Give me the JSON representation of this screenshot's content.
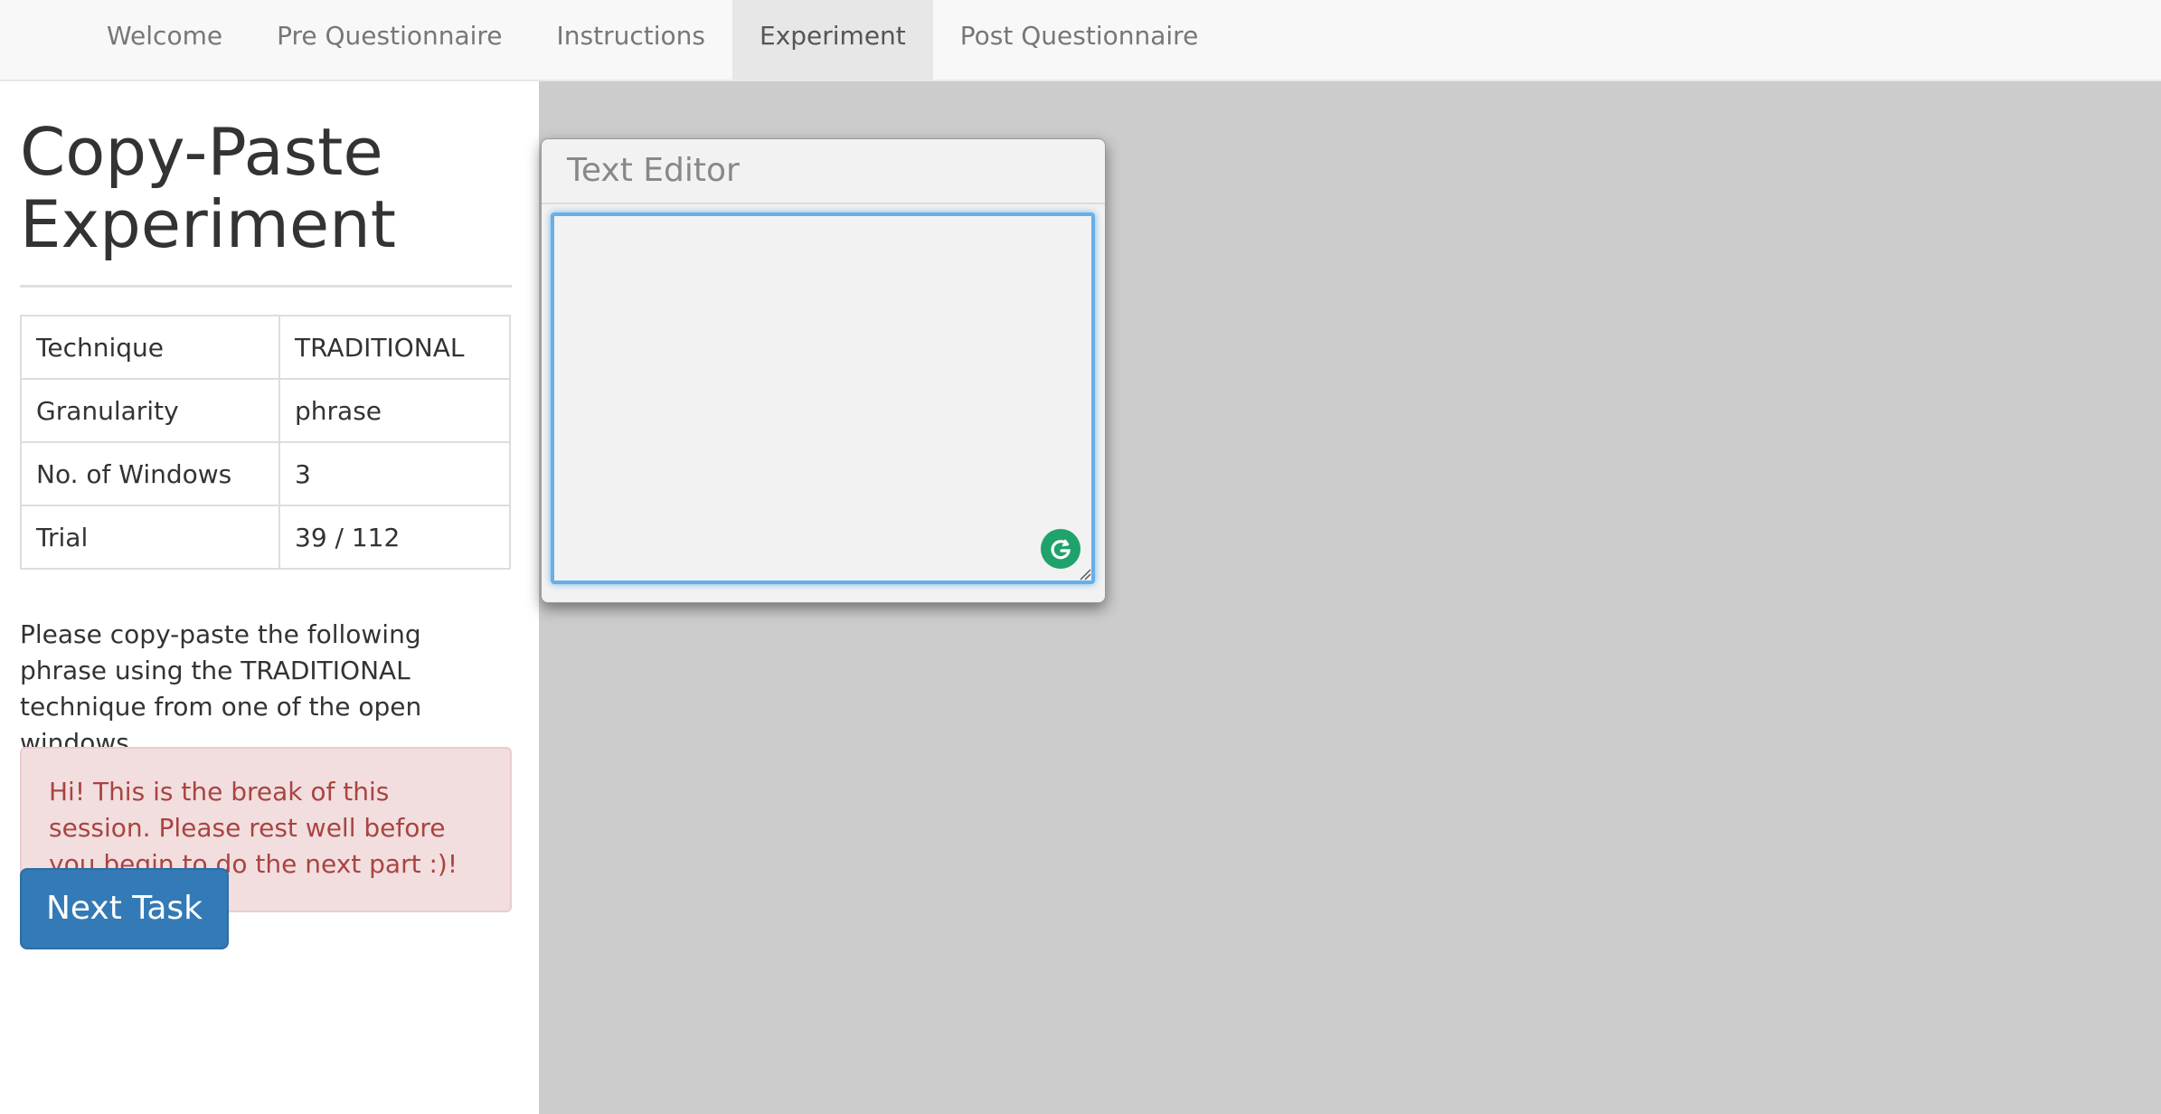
{
  "nav": {
    "items": [
      {
        "label": "Welcome",
        "active": false
      },
      {
        "label": "Pre Questionnaire",
        "active": false
      },
      {
        "label": "Instructions",
        "active": false
      },
      {
        "label": "Experiment",
        "active": true
      },
      {
        "label": "Post Questionnaire",
        "active": false
      }
    ]
  },
  "sidebar": {
    "title_line1": "Copy-Paste",
    "title_line2": "Experiment",
    "table": [
      {
        "key": "Technique",
        "value": "TRADITIONAL"
      },
      {
        "key": "Granularity",
        "value": "phrase"
      },
      {
        "key": "No. of Windows",
        "value": "3"
      },
      {
        "key": "Trial",
        "value": "39 / 112"
      }
    ],
    "instructions": "Please copy-paste the following phrase using the TRADITIONAL technique from one of the open windows.",
    "alert": "Hi! This is the break of this session. Please rest well before you begin to do the next part :)!",
    "next_button_label": "Next Task"
  },
  "editor": {
    "title": "Text Editor",
    "content": "",
    "grammarly_icon": "grammarly-icon"
  },
  "colors": {
    "primary_button": "#337ab7",
    "alert_background": "#f2dede",
    "alert_text": "#a94442",
    "workspace_background": "#cccccc",
    "focus_ring": "#66afe9",
    "grammarly": "#1fa26b"
  }
}
